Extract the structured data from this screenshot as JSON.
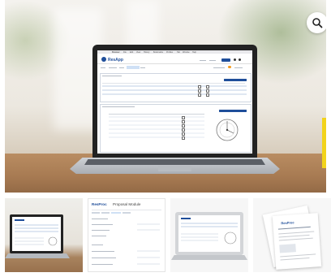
{
  "hero": {
    "app": {
      "brand": "ResApp",
      "menu": [
        "Browser",
        "File",
        "Edit",
        "View",
        "History",
        "Bookmarks",
        "Profiles",
        "Tab",
        "Window",
        "Help"
      ]
    }
  },
  "thumbnail_2": {
    "logo": "ResProc",
    "title": "Proposal Module"
  },
  "thumbnail_4": {
    "logo": "ResProc"
  },
  "colors": {
    "brand_blue": "#1f4e9a",
    "accent_yellow": "#f2d31b",
    "accent_orange": "#f39b1f"
  },
  "icons": {
    "zoom": "magnifier-icon"
  }
}
